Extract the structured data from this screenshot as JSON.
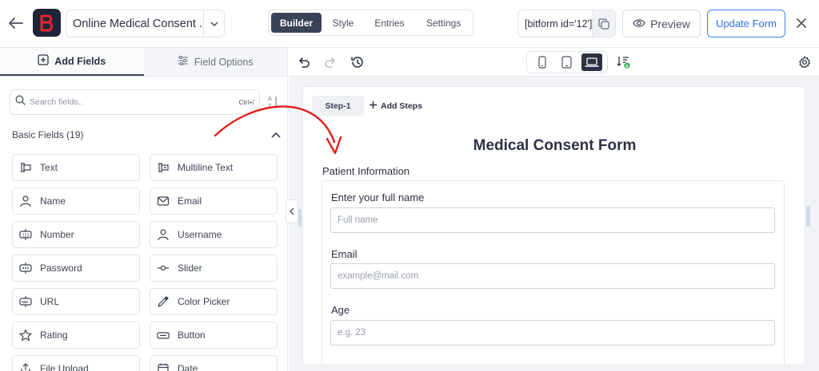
{
  "topbar": {
    "form_title": "Online Medical Consent ...",
    "tabs": [
      {
        "label": "Builder",
        "active": true
      },
      {
        "label": "Style",
        "active": false
      },
      {
        "label": "Entries",
        "active": false
      },
      {
        "label": "Settings",
        "active": false
      }
    ],
    "shortcode": "[bitform id='12']",
    "preview_label": "Preview",
    "update_label": "Update Form",
    "accent_color": "#2f6fe4",
    "logo_color": "#e3262f"
  },
  "left_panel": {
    "tabs": [
      {
        "label": "Add Fields",
        "active": true
      },
      {
        "label": "Field Options",
        "active": false
      }
    ],
    "search": {
      "placeholder": "Search fields..",
      "shortcut": "Ctrl+/"
    },
    "section_title": "Basic Fields (19)",
    "fields": [
      {
        "label": "Text",
        "icon": "text-field-icon"
      },
      {
        "label": "Multiline Text",
        "icon": "multiline-text-icon"
      },
      {
        "label": "Name",
        "icon": "user-icon"
      },
      {
        "label": "Email",
        "icon": "envelope-icon"
      },
      {
        "label": "Number",
        "icon": "number-icon"
      },
      {
        "label": "Username",
        "icon": "user-icon"
      },
      {
        "label": "Password",
        "icon": "password-icon"
      },
      {
        "label": "Slider",
        "icon": "slider-icon"
      },
      {
        "label": "URL",
        "icon": "url-icon"
      },
      {
        "label": "Color Picker",
        "icon": "eyedropper-icon"
      },
      {
        "label": "Rating",
        "icon": "star-icon"
      },
      {
        "label": "Button",
        "icon": "button-icon"
      },
      {
        "label": "File Upload",
        "icon": "upload-icon"
      },
      {
        "label": "Date",
        "icon": "calendar-icon"
      }
    ]
  },
  "toolbar": {
    "icons": [
      "undo-icon",
      "redo-icon",
      "history-icon",
      "mobile-icon",
      "tablet-icon",
      "laptop-icon",
      "sort-download-icon",
      "gear-icon"
    ],
    "active_device": "laptop"
  },
  "form": {
    "step_label": "Step-1",
    "add_steps_label": "Add Steps",
    "heading": "Medical Consent Form",
    "section_label": "Patient Information",
    "fields": [
      {
        "label": "Enter your full name",
        "placeholder": "Full name"
      },
      {
        "label": "Email",
        "placeholder": "example@mail.com"
      },
      {
        "label": "Age",
        "placeholder": "e.g. 23"
      }
    ]
  },
  "annotation_color": "#e0201d"
}
